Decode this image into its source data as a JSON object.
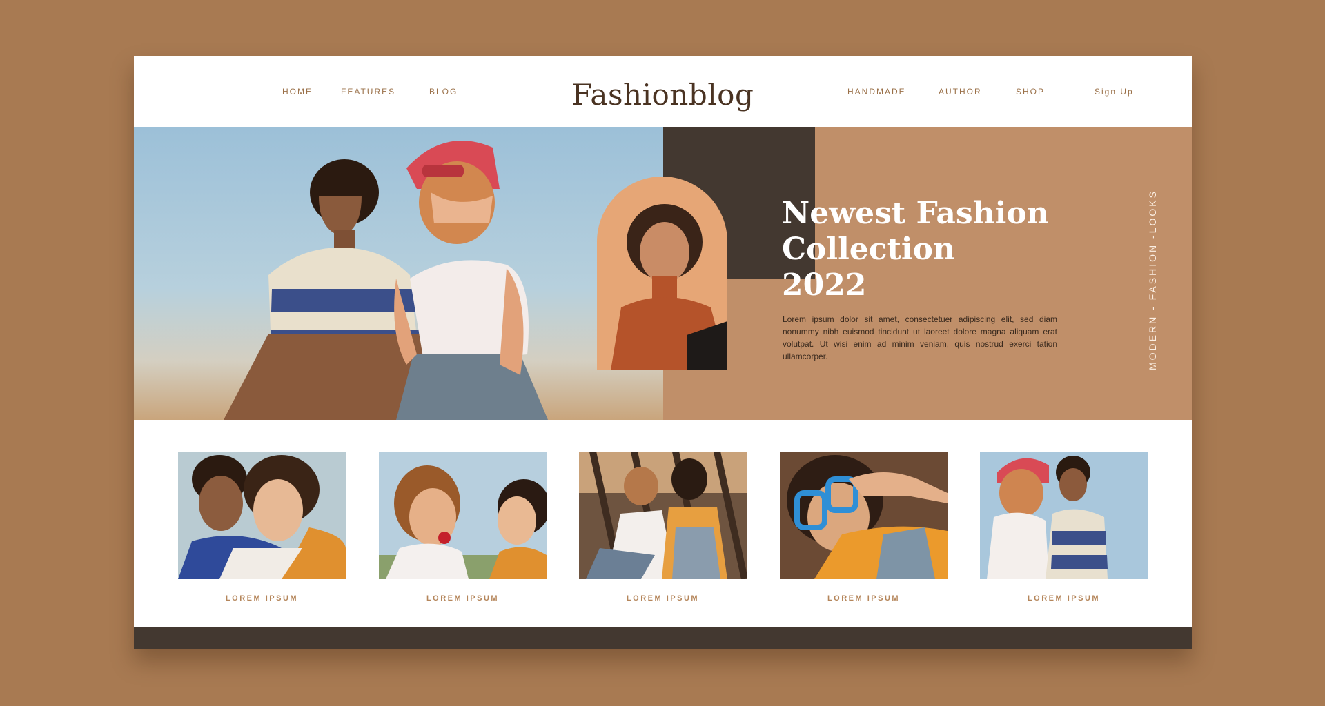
{
  "nav": {
    "left": [
      {
        "label": "HOME"
      },
      {
        "label": "FEATURES"
      },
      {
        "label": "BLOG"
      }
    ],
    "brand": "Fashionblog",
    "right": [
      {
        "label": "HANDMADE"
      },
      {
        "label": "AUTHOR"
      },
      {
        "label": "SHOP"
      }
    ],
    "signup": "Sign Up"
  },
  "hero": {
    "title_lines": [
      "Newest Fashion",
      "Collection",
      "2022"
    ],
    "body": "Lorem ipsum dolor sit amet, consectetuer adipiscing elit, sed diam nonummy nibh euismod tincidunt ut laoreet dolore magna aliquam erat volutpat. Ut wisi enim ad minim veniam, quis nostrud exerci tation ullamcorper.",
    "vertical_tag": "MODERN - FASHION -LOOKS"
  },
  "gallery": [
    {
      "caption": "LOREM IPSUM"
    },
    {
      "caption": "LOREM IPSUM"
    },
    {
      "caption": "LOREM IPSUM"
    },
    {
      "caption": "LOREM IPSUM"
    },
    {
      "caption": "LOREM IPSUM"
    }
  ],
  "colors": {
    "page_bg": "#a87a52",
    "brand_text": "#4a3322",
    "nav_text": "#9a7048",
    "hero_panel": "#c08f69",
    "dark_accent": "#433830",
    "caption": "#b5865b"
  }
}
